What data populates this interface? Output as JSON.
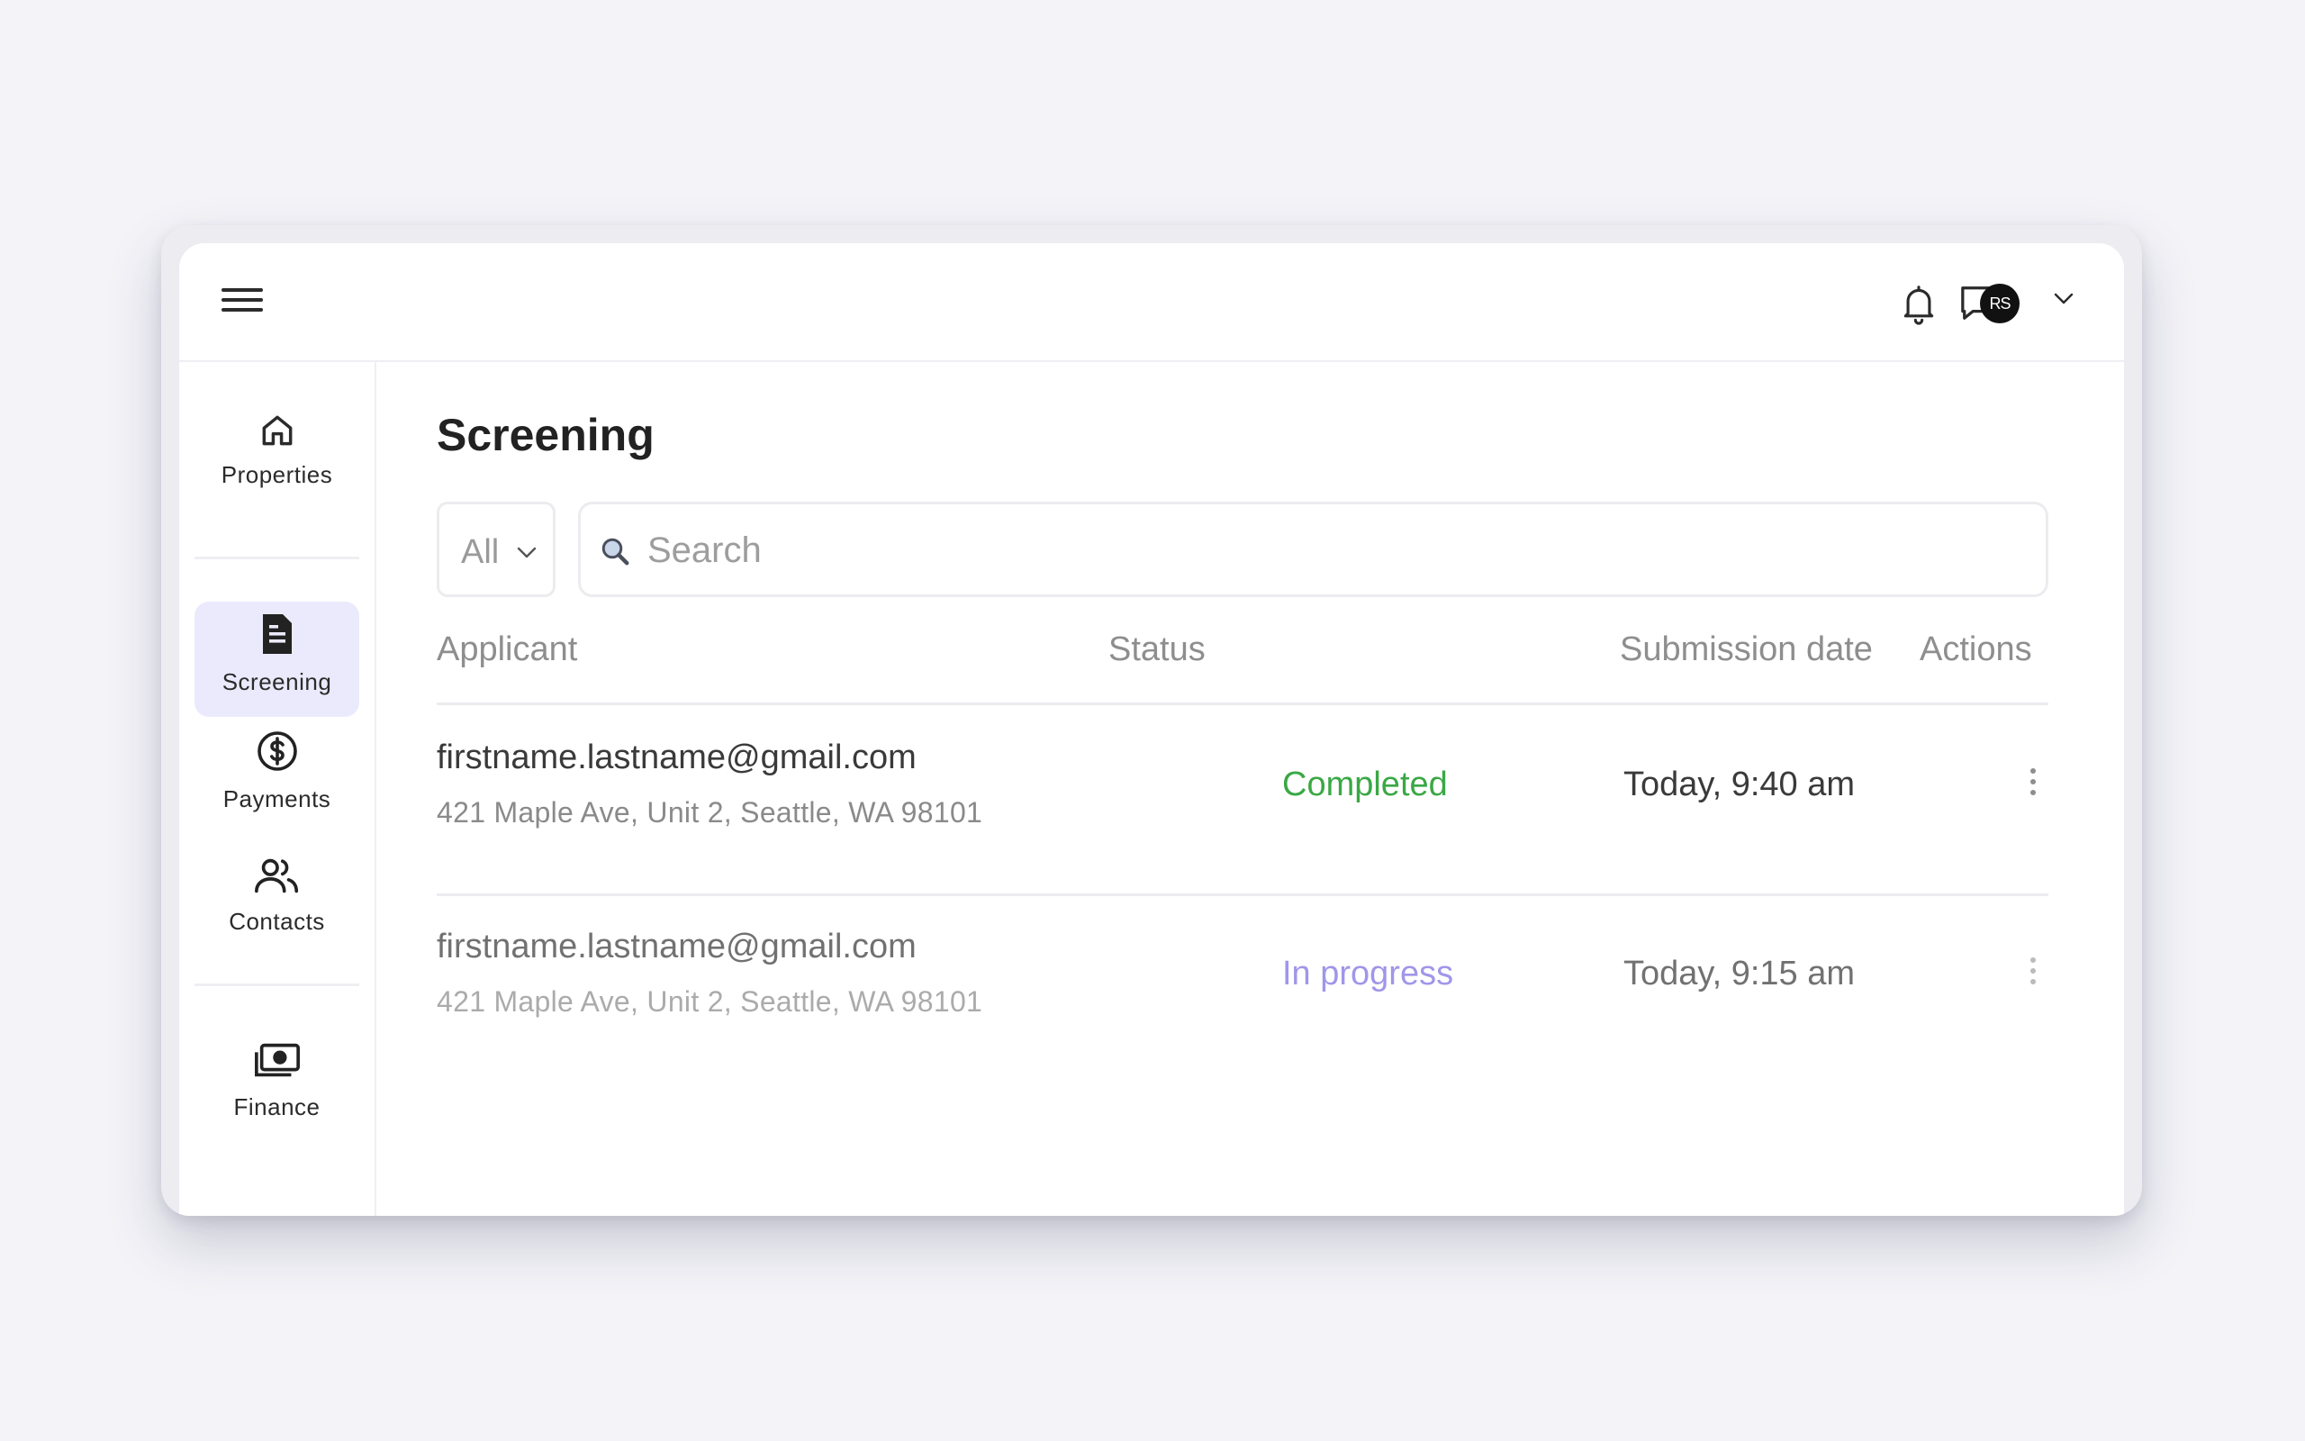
{
  "topbar": {
    "avatar_initials": "RS"
  },
  "sidebar": {
    "items": [
      {
        "label": "Properties",
        "icon": "home-icon"
      },
      {
        "label": "Screening",
        "icon": "document-icon",
        "active": true
      },
      {
        "label": "Payments",
        "icon": "dollar-circle-icon"
      },
      {
        "label": "Contacts",
        "icon": "users-icon"
      },
      {
        "label": "Finance",
        "icon": "money-icon"
      }
    ]
  },
  "main": {
    "title": "Screening",
    "filter": {
      "value": "All"
    },
    "search": {
      "placeholder": "Search"
    },
    "table": {
      "columns": [
        "Applicant",
        "Status",
        "Submission date",
        "Actions"
      ],
      "rows": [
        {
          "email": "firstname.lastname@gmail.com",
          "address": "421 Maple Ave, Unit 2, Seattle, WA 98101",
          "status": "Completed",
          "date": "Today, 9:40 am"
        },
        {
          "email": "firstname.lastname@gmail.com",
          "address": "421 Maple Ave, Unit 2, Seattle, WA 98101",
          "status": "In progress",
          "date": "Today, 9:15 am"
        }
      ]
    }
  },
  "colors": {
    "accent": "#ebeafc",
    "status_completed": "#3aa845",
    "status_in_progress": "#8b7fe0"
  }
}
